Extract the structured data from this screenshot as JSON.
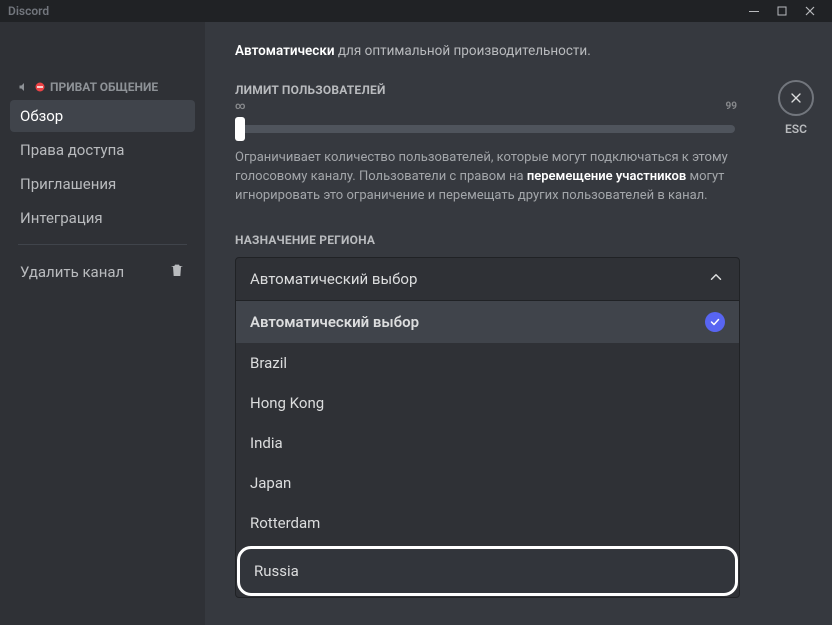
{
  "titlebar": {
    "app_name": "Discord"
  },
  "sidebar": {
    "category_label": "ПРИВАТ ОБЩЕНИЕ",
    "items": [
      {
        "label": "Обзор"
      },
      {
        "label": "Права доступа"
      },
      {
        "label": "Приглашения"
      },
      {
        "label": "Интеграция"
      }
    ],
    "delete_label": "Удалить канал"
  },
  "esc": {
    "label": "ESC"
  },
  "top_desc": {
    "bold": "Автоматически",
    "rest": " для оптимальной производительности."
  },
  "user_limit": {
    "label": "ЛИМИТ ПОЛЬЗОВАТЕЛЕЙ",
    "min": "∞",
    "max": "99",
    "help_pre": "Ограничивает количество пользователей, которые могут подключаться к этому голосовому каналу. Пользователи с правом на ",
    "help_bold": "перемещение участников",
    "help_post": " могут игнорировать это ограничение и перемещать других пользователей в канал."
  },
  "region": {
    "label": "НАЗНАЧЕНИЕ РЕГИОНА",
    "selected": "Автоматический выбор",
    "options": [
      "Автоматический выбор",
      "Brazil",
      "Hong Kong",
      "India",
      "Japan",
      "Rotterdam",
      "Russia"
    ]
  }
}
